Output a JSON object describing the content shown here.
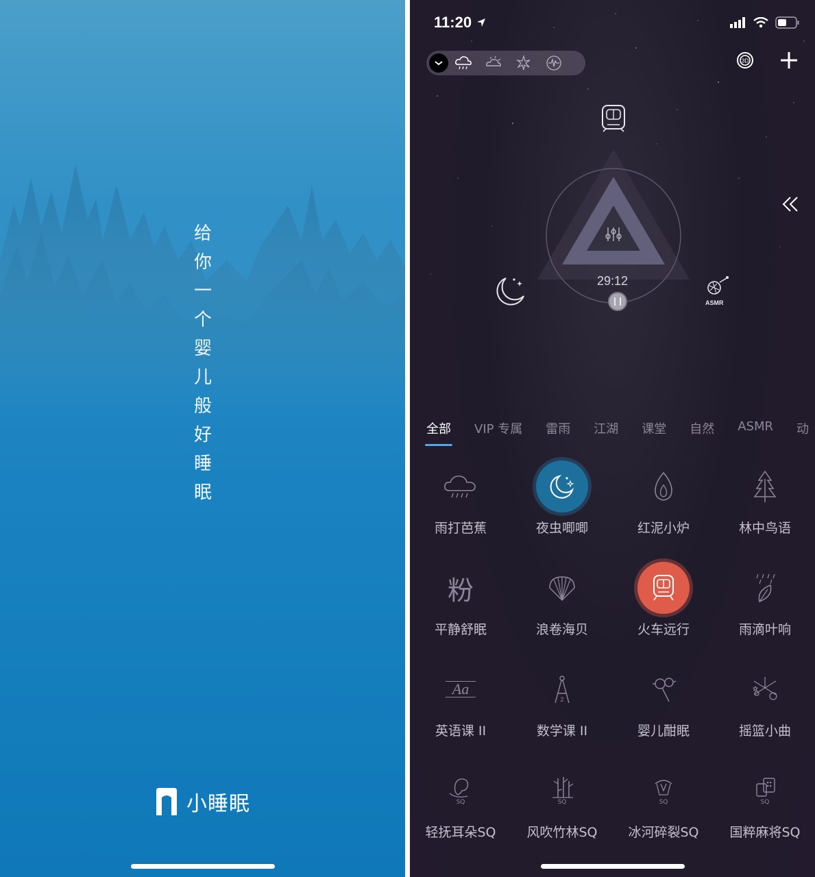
{
  "splash": {
    "tagline_chars": [
      "给",
      "你",
      "一",
      "个",
      "婴",
      "儿",
      "般",
      "好",
      "睡",
      "眠"
    ],
    "logo_text": "小睡眠"
  },
  "status_bar": {
    "time": "11:20"
  },
  "toolbar": {
    "icons": [
      "chevron-down-icon",
      "rain-cloud-icon",
      "storm-icon",
      "sparkle-icon",
      "wave-icon"
    ],
    "right_icons": [
      "3d-icon",
      "plus-icon"
    ]
  },
  "player": {
    "timer": "29:12",
    "top_icon": "train-icon",
    "left_icon": "moon-stars-icon",
    "right_label": "ASMR"
  },
  "tabs": [
    {
      "label": "全部",
      "active": true
    },
    {
      "label": "VIP 专属",
      "active": false
    },
    {
      "label": "雷雨",
      "active": false
    },
    {
      "label": "江湖",
      "active": false
    },
    {
      "label": "课堂",
      "active": false
    },
    {
      "label": "自然",
      "active": false
    },
    {
      "label": "ASMR",
      "active": false
    },
    {
      "label": "动",
      "active": false
    }
  ],
  "sounds": [
    {
      "label": "雨打芭蕉",
      "icon": "rain-cloud-icon",
      "state": "off"
    },
    {
      "label": "夜虫唧唧",
      "icon": "moon-icon",
      "state": "blue"
    },
    {
      "label": "红泥小炉",
      "icon": "flame-icon",
      "state": "off"
    },
    {
      "label": "林中鸟语",
      "icon": "tree-icon",
      "state": "off"
    },
    {
      "label": "平静舒眠",
      "icon": "fen-char-icon",
      "state": "off",
      "glyph": "粉"
    },
    {
      "label": "浪卷海贝",
      "icon": "shell-icon",
      "state": "off"
    },
    {
      "label": "火车远行",
      "icon": "train-icon",
      "state": "red"
    },
    {
      "label": "雨滴叶响",
      "icon": "leaf-rain-icon",
      "state": "off"
    },
    {
      "label": "英语课 II",
      "icon": "letters-icon",
      "state": "off",
      "glyph": "Aa"
    },
    {
      "label": "数学课 II",
      "icon": "compass-icon",
      "state": "off"
    },
    {
      "label": "婴儿酣眠",
      "icon": "rattle-icon",
      "state": "off"
    },
    {
      "label": "摇篮小曲",
      "icon": "mobile-icon",
      "state": "off"
    },
    {
      "label": "轻抚耳朵SQ",
      "icon": "ear-icon",
      "state": "off",
      "badge": "SQ"
    },
    {
      "label": "风吹竹林SQ",
      "icon": "bamboo-icon",
      "state": "off",
      "badge": "SQ"
    },
    {
      "label": "冰河碎裂SQ",
      "icon": "ice-icon",
      "state": "off",
      "badge": "SQ"
    },
    {
      "label": "国粹麻将SQ",
      "icon": "mahjong-icon",
      "state": "off",
      "badge": "SQ"
    }
  ]
}
